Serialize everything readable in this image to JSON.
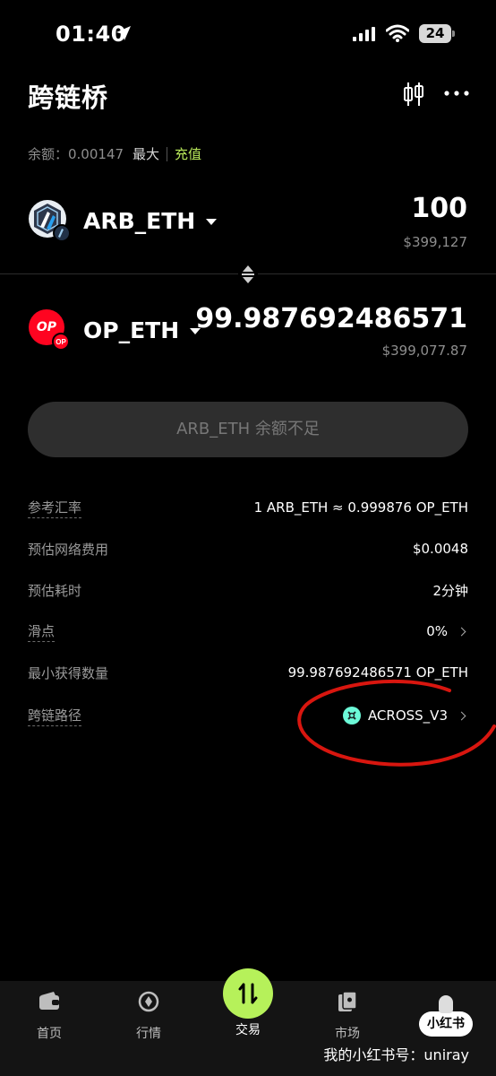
{
  "status_bar": {
    "time": "01:40",
    "battery": "24"
  },
  "header": {
    "title": "跨链桥"
  },
  "balance": {
    "label": "余额：0.00147",
    "max": "最大",
    "deposit": "充值"
  },
  "from": {
    "token": "ARB_ETH",
    "amount": "100",
    "usd": "$399,127"
  },
  "to": {
    "token": "OP_ETH",
    "amount": "99.987692486571",
    "usd": "$399,077.87",
    "logo_text": "OP"
  },
  "action": {
    "label": "ARB_ETH 余额不足"
  },
  "details": [
    {
      "label": "参考汇率",
      "value": "1 ARB_ETH ≈ 0.999876 OP_ETH"
    },
    {
      "label": "预估网络费用",
      "value": "$0.0048"
    },
    {
      "label": "预估耗时",
      "value": "2分钟"
    },
    {
      "label": "滑点",
      "value": "0%"
    },
    {
      "label": "最小获得数量",
      "value": "99.987692486571 OP_ETH"
    },
    {
      "label": "跨链路径",
      "value": "ACROSS_V3"
    }
  ],
  "nav": {
    "home": "首页",
    "market": "行情",
    "trade": "交易",
    "bazaar": "市场",
    "badge": "小红书"
  },
  "watermark": "我的小红书号：uniray",
  "colors": {
    "accent": "#b6f15a",
    "op_red": "#ff0420",
    "across": "#6cf9d8",
    "annotation": "#d8160f"
  }
}
